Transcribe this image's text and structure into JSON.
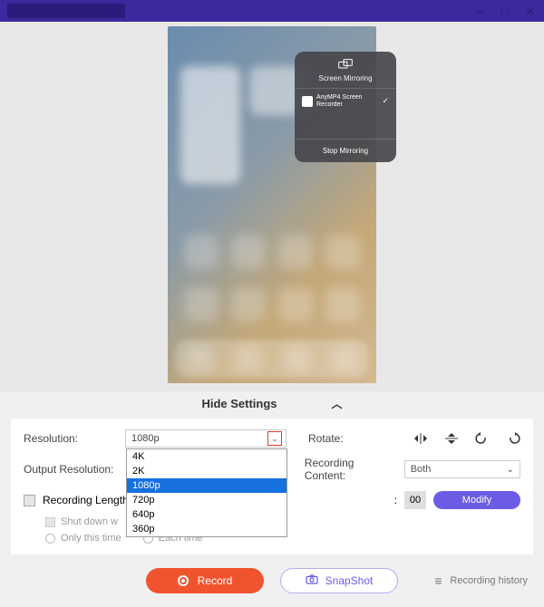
{
  "mirror": {
    "title": "Screen Mirroring",
    "item": "AnyMP4 Screen Recorder",
    "stop": "Stop Mirroring"
  },
  "hideSettings": "Hide Settings",
  "labels": {
    "resolution": "Resolution:",
    "outputResolution": "Output Resolution:",
    "rotate": "Rotate:",
    "recordingContent": "Recording Content:",
    "recordingLength": "Recording Length",
    "shutDown": "Shut down w",
    "onlyThis": "Only this time",
    "eachTime": "Each time"
  },
  "resolution": {
    "selected": "1080p",
    "options": [
      "4K",
      "2K",
      "1080p",
      "720p",
      "640p",
      "360p"
    ]
  },
  "recordingContent": {
    "selected": "Both"
  },
  "time": {
    "colon": ":",
    "sec": "00"
  },
  "buttons": {
    "modify": "Modify",
    "record": "Record",
    "snapshot": "SnapShot",
    "history": "Recording history"
  }
}
